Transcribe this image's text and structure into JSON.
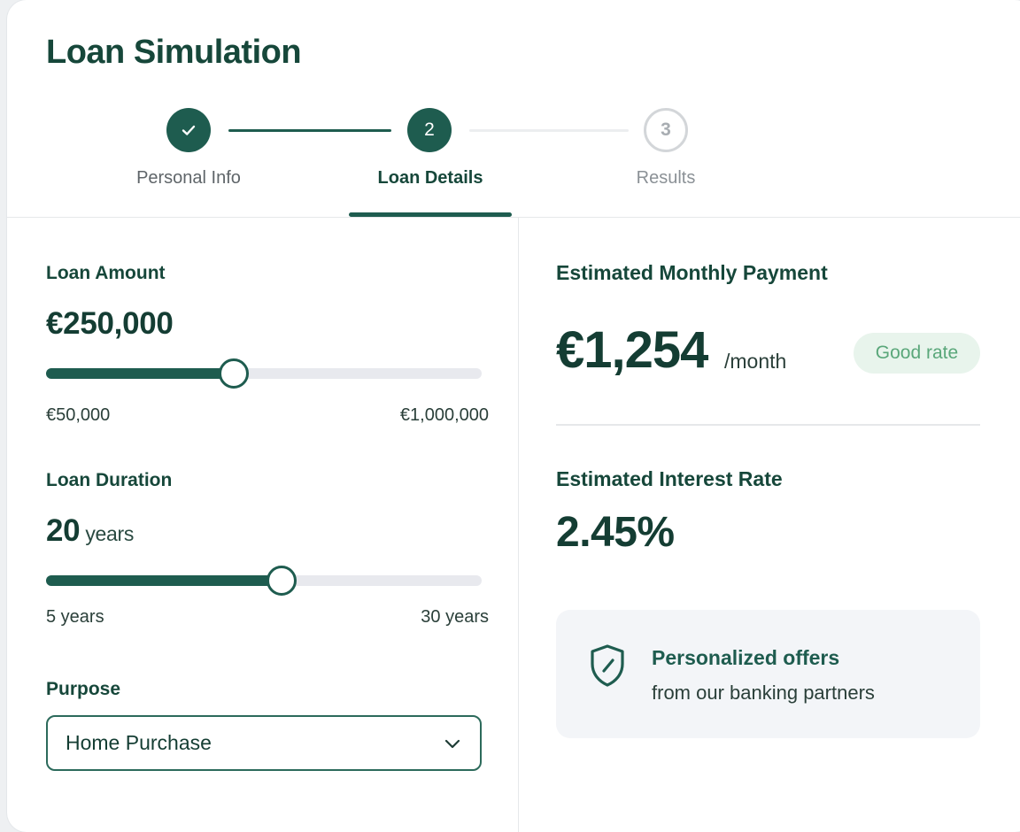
{
  "title": "Loan Simulation",
  "stepper": {
    "steps": [
      {
        "number": "",
        "label": "Personal Info",
        "state": "completed",
        "icon": "check-icon"
      },
      {
        "number": "2",
        "label": "Loan Details",
        "state": "active"
      },
      {
        "number": "3",
        "label": "Results",
        "state": "upcoming"
      }
    ]
  },
  "loan_amount": {
    "label": "Loan Amount",
    "value": "€250,000",
    "min_label": "€50,000",
    "max_label": "€1,000,000",
    "slider_fraction": 0.43
  },
  "loan_duration": {
    "label": "Loan Duration",
    "value": "20",
    "unit": "years",
    "min_label": "5 years",
    "max_label": "30 years",
    "slider_fraction": 0.54
  },
  "purpose": {
    "label": "Purpose",
    "selected": "Home Purchase",
    "icon": "chevron-down-icon"
  },
  "results": {
    "monthly_label": "Estimated Monthly Payment",
    "monthly_value": "€1,254",
    "monthly_unit": "/month",
    "badge": "Good rate",
    "rate_label": "Estimated Interest Rate",
    "rate_value": "2.45%"
  },
  "offer": {
    "icon": "shield-icon",
    "title": "Personalized offers",
    "subtitle": "from our banking partners"
  },
  "colors": {
    "primary": "#1e5c4f",
    "text_dark": "#143d33",
    "badge_bg": "#e8f4ec",
    "badge_text": "#5aa77a",
    "track": "#e8e9ee"
  }
}
